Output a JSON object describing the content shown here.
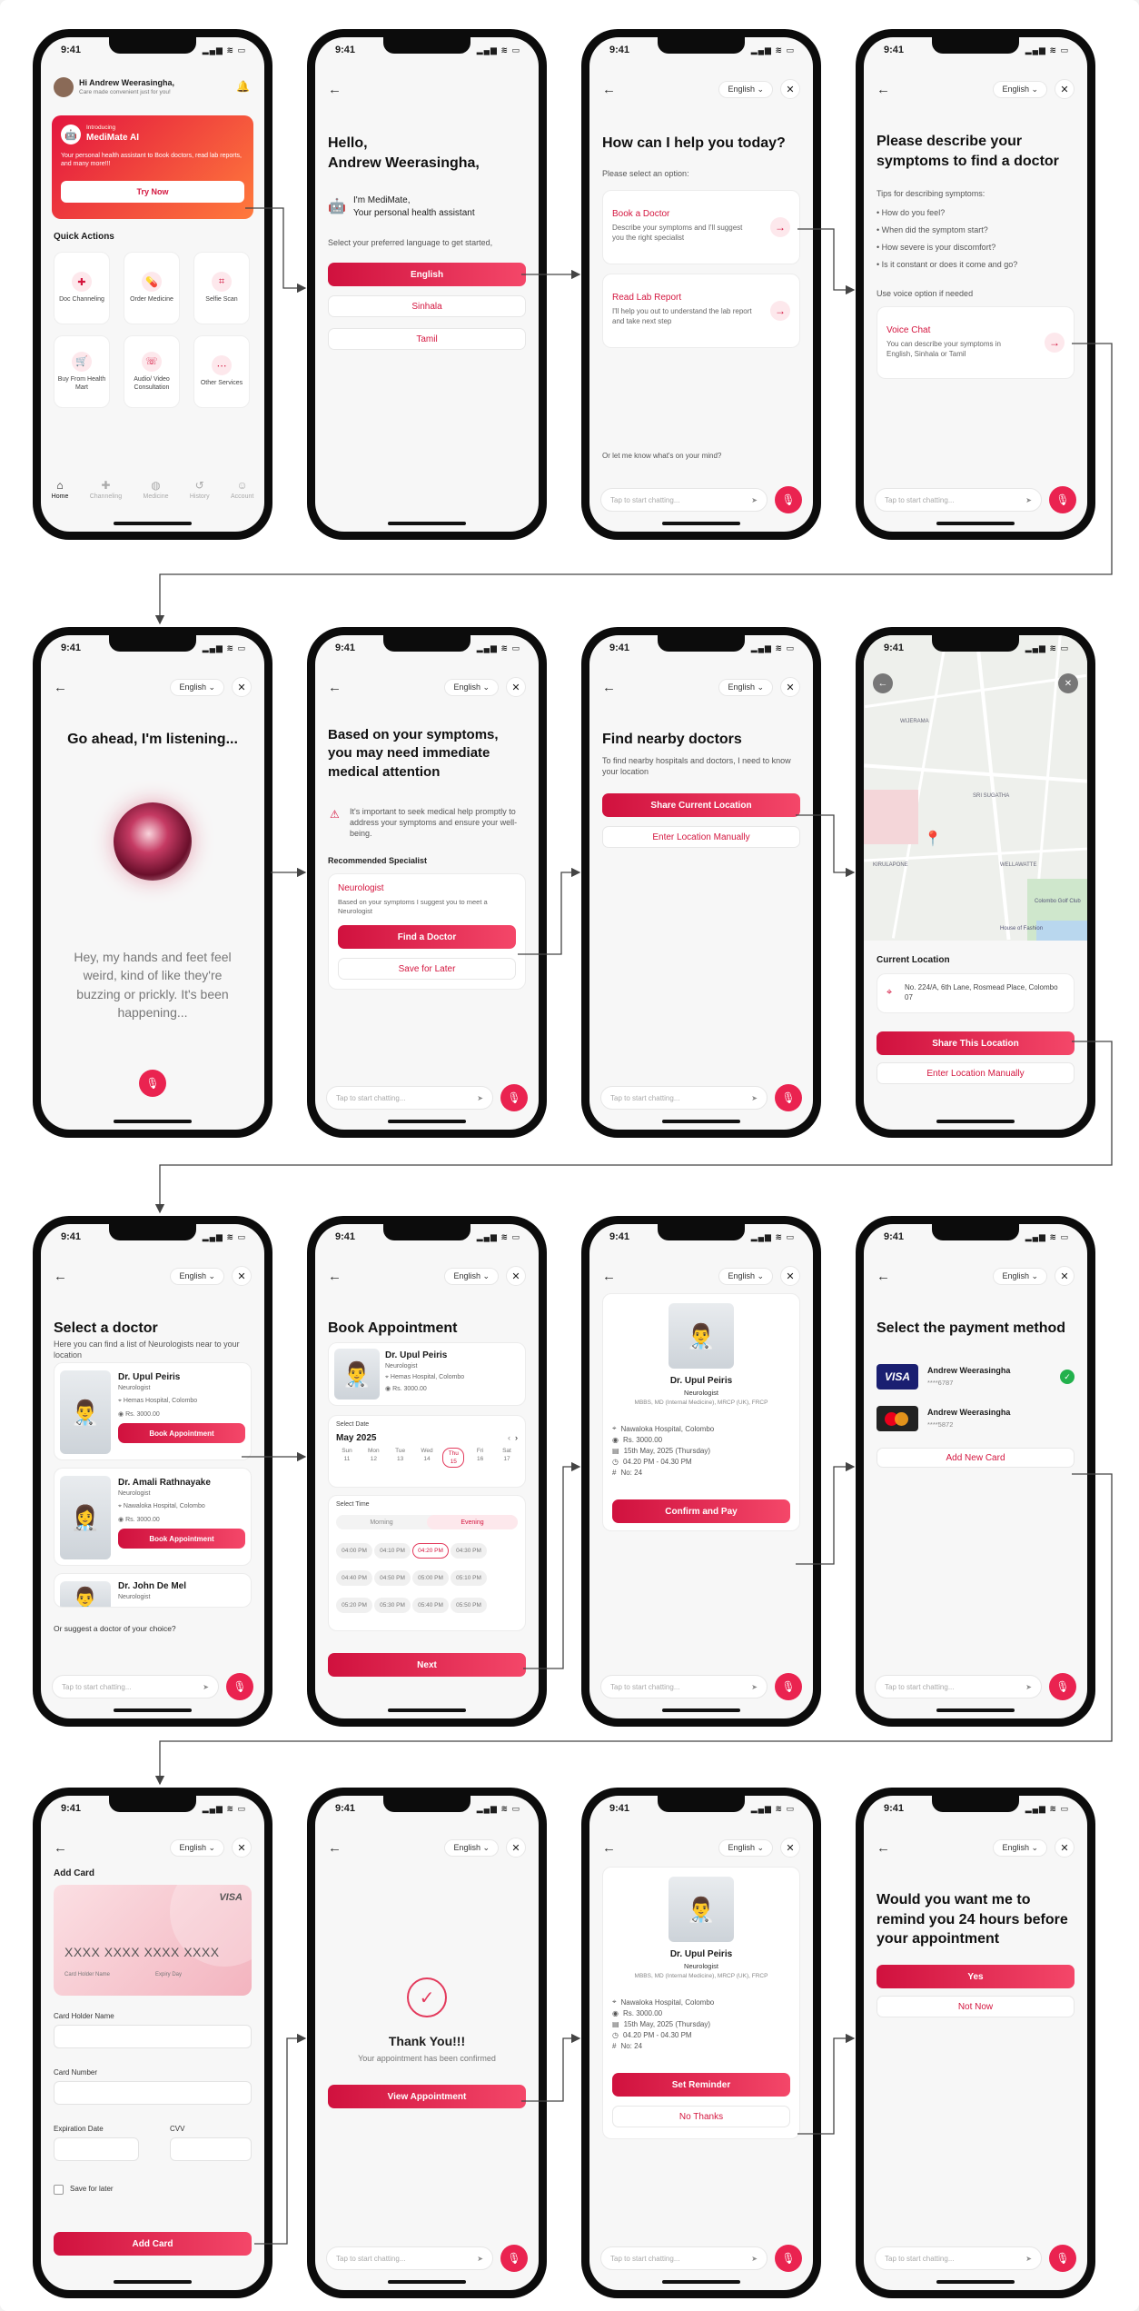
{
  "status": {
    "time": "9:41",
    "icons": "▂▄▆ ≋ ▭"
  },
  "common": {
    "lang": "English ⌄",
    "chat_placeholder": "Tap to start chatting...",
    "back": "←",
    "close": "✕",
    "send": "➤",
    "mic": "🎙",
    "arrow": "→"
  },
  "s1": {
    "greeting": "Hi Andrew Weerasingha,",
    "sub": "Care made convenient just for you!",
    "intro": "Introducing",
    "ai_name": "MediMate AI",
    "ai_desc": "Your personal health assistant to Book doctors, read lab reports, and many more!!!",
    "try": "Try Now",
    "qa_title": "Quick Actions",
    "actions": [
      "Doc Channeling",
      "Order Medicine",
      "Selfie Scan",
      "Buy From Health Mart",
      "Audio/ Video Consultation",
      "Other Services"
    ],
    "tabs": [
      "Home",
      "Channeling",
      "Medicine",
      "History",
      "Account"
    ]
  },
  "s2": {
    "hello": "Hello,",
    "name": "Andrew Weerasingha,",
    "im": "I'm MediMate,",
    "assistant": "Your personal health assistant",
    "select": "Select your preferred language to get started,",
    "langs": [
      "English",
      "Sinhala",
      "Tamil"
    ]
  },
  "s3": {
    "title": "How can I help you today?",
    "select": "Please select an option:",
    "opt1_t": "Book a Doctor",
    "opt1_d": "Describe your symptoms and I'll suggest you the right specialist",
    "opt2_t": "Read Lab Report",
    "opt2_d": "I'll help you out to understand the lab report and take next step",
    "mind": "Or let me know what's on your mind?"
  },
  "s4": {
    "title": "Please describe your symptoms to find a doctor",
    "tips": "Tips for describing symptoms:",
    "tip_list": [
      "• How do you feel?",
      "• When did the symptom start?",
      "• How severe is your discomfort?",
      "• Is it constant or does it come and go?"
    ],
    "voice_opt": "Use voice option if needed",
    "voice_t": "Voice Chat",
    "voice_d": "You can describe your symptoms in English, Sinhala or Tamil"
  },
  "s5": {
    "title": "Go ahead, I'm listening...",
    "transcript": "Hey, my hands and feet feel weird, kind of like they're buzzing or prickly. It's been happening..."
  },
  "s6": {
    "title": "Based on your symptoms, you may need immediate medical attention",
    "warn": "It's important to seek medical help promptly to address your symptoms and ensure your well-being.",
    "rec": "Recommended Specialist",
    "spec": "Neurologist",
    "spec_d": "Based on your symptoms I suggest you to meet a Neurologist",
    "find": "Find a Doctor",
    "save": "Save for Later"
  },
  "s7": {
    "title": "Find nearby doctors",
    "desc": "To find nearby hospitals and doctors, I need to know your location",
    "share": "Share Current Location",
    "manual": "Enter Location Manually"
  },
  "s8": {
    "cur": "Current Location",
    "addr": "No. 224/A, 6th Lane, Rosmead Place, Colombo 07",
    "share": "Share This Location",
    "manual": "Enter Location Manually",
    "map_labels": [
      "WIJERAMA",
      "SRI SUGATHA",
      "KIRULAPONE",
      "WELLAWATTE",
      "Colombo Golf Club",
      "House of Fashion"
    ]
  },
  "s9": {
    "title": "Select a doctor",
    "desc": "Here you can find a list of Neurologists near to your location",
    "docs": [
      {
        "name": "Dr. Upul Peiris",
        "spec": "Neurologist",
        "hosp": "Hemas Hospital, Colombo",
        "fee": "Rs. 3000.00"
      },
      {
        "name": "Dr. Amali Rathnayake",
        "spec": "Neurologist",
        "hosp": "Nawaloka Hospital, Colombo",
        "fee": "Rs. 3000.00"
      },
      {
        "name": "Dr. John De Mel",
        "spec": "Neurologist"
      }
    ],
    "book": "Book Appointment",
    "suggest": "Or suggest a doctor of your choice?"
  },
  "s10": {
    "title": "Book Appointment",
    "doc": "Dr. Upul Peiris",
    "spec": "Neurologist",
    "hosp": "Hemas Hospital, Colombo",
    "fee": "Rs. 3000.00",
    "sel_date": "Select Date",
    "month": "May 2025",
    "days": [
      {
        "d": "Sun",
        "n": "11"
      },
      {
        "d": "Mon",
        "n": "12"
      },
      {
        "d": "Tue",
        "n": "13"
      },
      {
        "d": "Wed",
        "n": "14"
      },
      {
        "d": "Thu",
        "n": "15"
      },
      {
        "d": "Fri",
        "n": "16"
      },
      {
        "d": "Sat",
        "n": "17"
      }
    ],
    "sel_time": "Select Time",
    "morning": "Morning",
    "evening": "Evening",
    "slots": [
      "04:00 PM",
      "04:10 PM",
      "04:20 PM",
      "04:30 PM",
      "04:40 PM",
      "04:50 PM",
      "05:00 PM",
      "05:10 PM",
      "05:20 PM",
      "05:30 PM",
      "05:40 PM",
      "05:50 PM"
    ],
    "next": "Next"
  },
  "s11": {
    "doc": "Dr. Upul Peiris",
    "spec": "Neurologist",
    "quals": "MBBS, MD (Internal Medicine), MRCP (UK), FRCP",
    "hosp": "Nawaloka Hospital, Colombo",
    "fee": "Rs. 3000.00",
    "date": "15th May, 2025 (Thursday)",
    "time": "04.20 PM - 04.30 PM",
    "no": "No: 24",
    "confirm": "Confirm and Pay"
  },
  "s12": {
    "title": "Select the payment method",
    "c1_name": "Andrew Weerasingha",
    "c1_num": "****6787",
    "c2_name": "Andrew Weerasingha",
    "c2_num": "****5872",
    "add": "Add New Card",
    "visa": "VISA"
  },
  "s13": {
    "title": "Add Card",
    "visa": "VISA",
    "num": "XXXX XXXX XXXX XXXX",
    "holder": "Card Holder Name",
    "expiry": "Expiry Day",
    "l_holder": "Card Holder Name",
    "l_number": "Card Number",
    "l_exp": "Expiration Date",
    "l_cvv": "CVV",
    "save": "Save for later",
    "add": "Add Card"
  },
  "s14": {
    "title": "Thank You!!!",
    "desc": "Your appointment has been confirmed",
    "view": "View Appointment"
  },
  "s15": {
    "doc": "Dr. Upul Peiris",
    "spec": "Neurologist",
    "quals": "MBBS, MD (Internal Medicine), MRCP (UK), FRCP",
    "hosp": "Nawaloka Hospital, Colombo",
    "fee": "Rs. 3000.00",
    "date": "15th May, 2025 (Thursday)",
    "time": "04.20 PM - 04.30 PM",
    "no": "No: 24",
    "set": "Set Reminder",
    "no_thanks": "No Thanks"
  },
  "s16": {
    "title": "Would you want me to remind you 24 hours before your appointment",
    "yes": "Yes",
    "not_now": "Not Now"
  }
}
